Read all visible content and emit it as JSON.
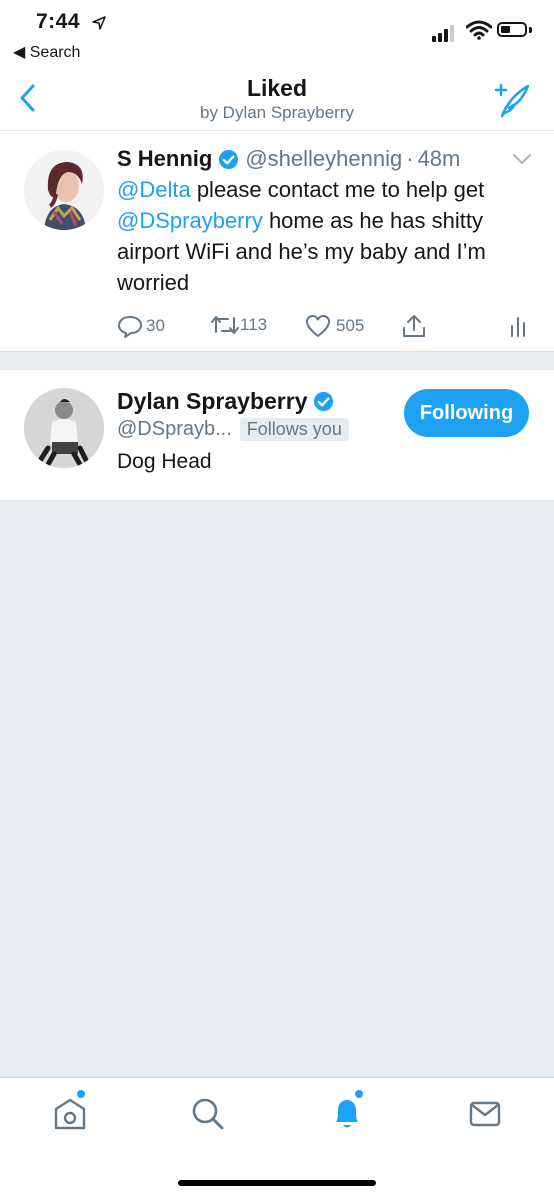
{
  "status_bar": {
    "time": "7:44",
    "back_label": "◀ Search"
  },
  "nav": {
    "title": "Liked",
    "subtitle": "by Dylan Sprayberry"
  },
  "tweet": {
    "name": "S Hennig",
    "handle": "@shelleyhennig",
    "separator": "·",
    "time": "48m",
    "text_parts": {
      "mention1": "@Delta",
      "t1": " please contact me to help get ",
      "mention2": "@DSprayberry",
      "t2": " home as he has shitty airport WiFi and he’s my baby and I’m worried"
    },
    "replies": "30",
    "retweets": "113",
    "likes": "505"
  },
  "user_card": {
    "name": "Dylan Sprayberry",
    "handle": "@DSprayb...",
    "follows_you": "Follows you",
    "bio": "Dog Head",
    "button_label": "Following"
  },
  "colors": {
    "accent": "#1da1f2",
    "muted": "#657786",
    "background": "#e6ecf0"
  }
}
